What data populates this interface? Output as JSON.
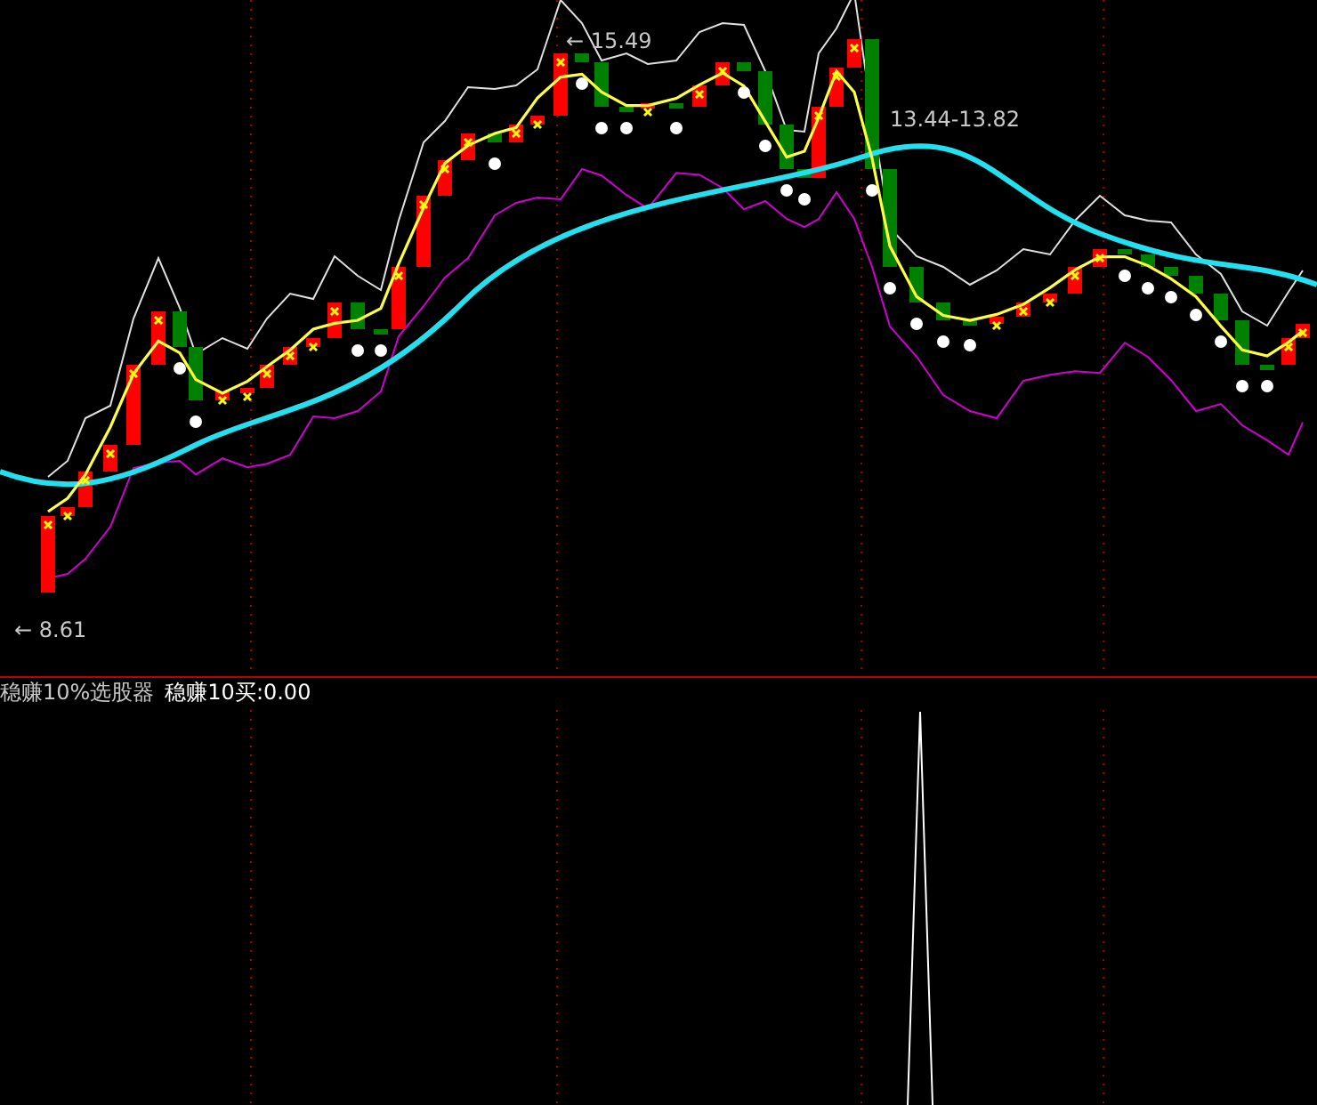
{
  "price_chart": {
    "high_label": "← 15.49",
    "range_label": "13.44-13.82",
    "low_label": "← 8.61"
  },
  "indicator": {
    "name": "稳赚10%选股器",
    "value": "稳赚10买:0.00"
  }
}
